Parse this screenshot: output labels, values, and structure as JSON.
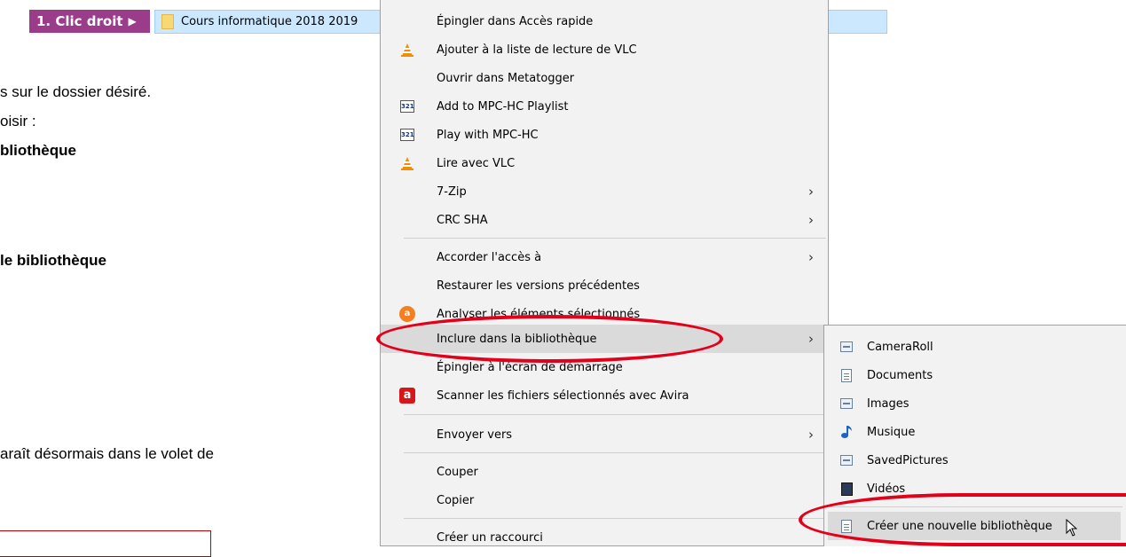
{
  "step": {
    "badge_label": "1. Clic droit",
    "arrow": "▶"
  },
  "folder_bar": {
    "name": "Cours informatique 2018 2019"
  },
  "document": {
    "lines": [
      "s sur le dossier désiré.",
      "oisir :",
      "bliothèque",
      "le bibliothèque",
      "araît désormais dans le volet de"
    ]
  },
  "context_menu": {
    "items": [
      {
        "label": "Épingler dans Accès rapide",
        "icon": ""
      },
      {
        "label": "Ajouter à la liste de lecture de VLC",
        "icon": "vlc-icon"
      },
      {
        "label": "Ouvrir dans Metatogger",
        "icon": ""
      },
      {
        "label": "Add to MPC-HC Playlist",
        "icon": "mpc-hc-icon"
      },
      {
        "label": "Play with MPC-HC",
        "icon": "mpc-hc-icon"
      },
      {
        "label": "Lire avec VLC",
        "icon": "vlc-icon"
      },
      {
        "label": "7-Zip",
        "icon": "",
        "submenu": true
      },
      {
        "label": "CRC SHA",
        "icon": "",
        "submenu": true
      },
      {
        "label": "Accorder l'accès à",
        "icon": "",
        "submenu": true
      },
      {
        "label": "Restaurer les versions précédentes",
        "icon": ""
      },
      {
        "label": "Analyser les éléments sélectionnés",
        "icon": "avast-icon"
      },
      {
        "label": "Inclure dans la bibliothèque",
        "icon": "",
        "submenu": true,
        "highlighted": true
      },
      {
        "label": "Épingler à l'écran de démarrage",
        "icon": ""
      },
      {
        "label": "Scanner les fichiers sélectionnés avec Avira",
        "icon": "avira-icon"
      },
      {
        "label": "Envoyer vers",
        "icon": "",
        "submenu": true
      },
      {
        "label": "Couper",
        "icon": ""
      },
      {
        "label": "Copier",
        "icon": ""
      },
      {
        "label": "Créer un raccourci",
        "icon": ""
      }
    ],
    "arrow_glyph": "›"
  },
  "submenu": {
    "items": [
      {
        "label": "CameraRoll",
        "icon": "library-icon"
      },
      {
        "label": "Documents",
        "icon": "documents-library-icon"
      },
      {
        "label": "Images",
        "icon": "library-icon"
      },
      {
        "label": "Musique",
        "icon": "music-note-icon"
      },
      {
        "label": "SavedPictures",
        "icon": "library-icon"
      },
      {
        "label": "Vidéos",
        "icon": "film-icon"
      },
      {
        "label": "Créer une nouvelle bibliothèque",
        "icon": "new-library-icon",
        "highlighted": true
      }
    ]
  },
  "annotation_color": "#e3001b",
  "menu_highlight_color": "#dadada",
  "badge_color": "#9b3c8b"
}
